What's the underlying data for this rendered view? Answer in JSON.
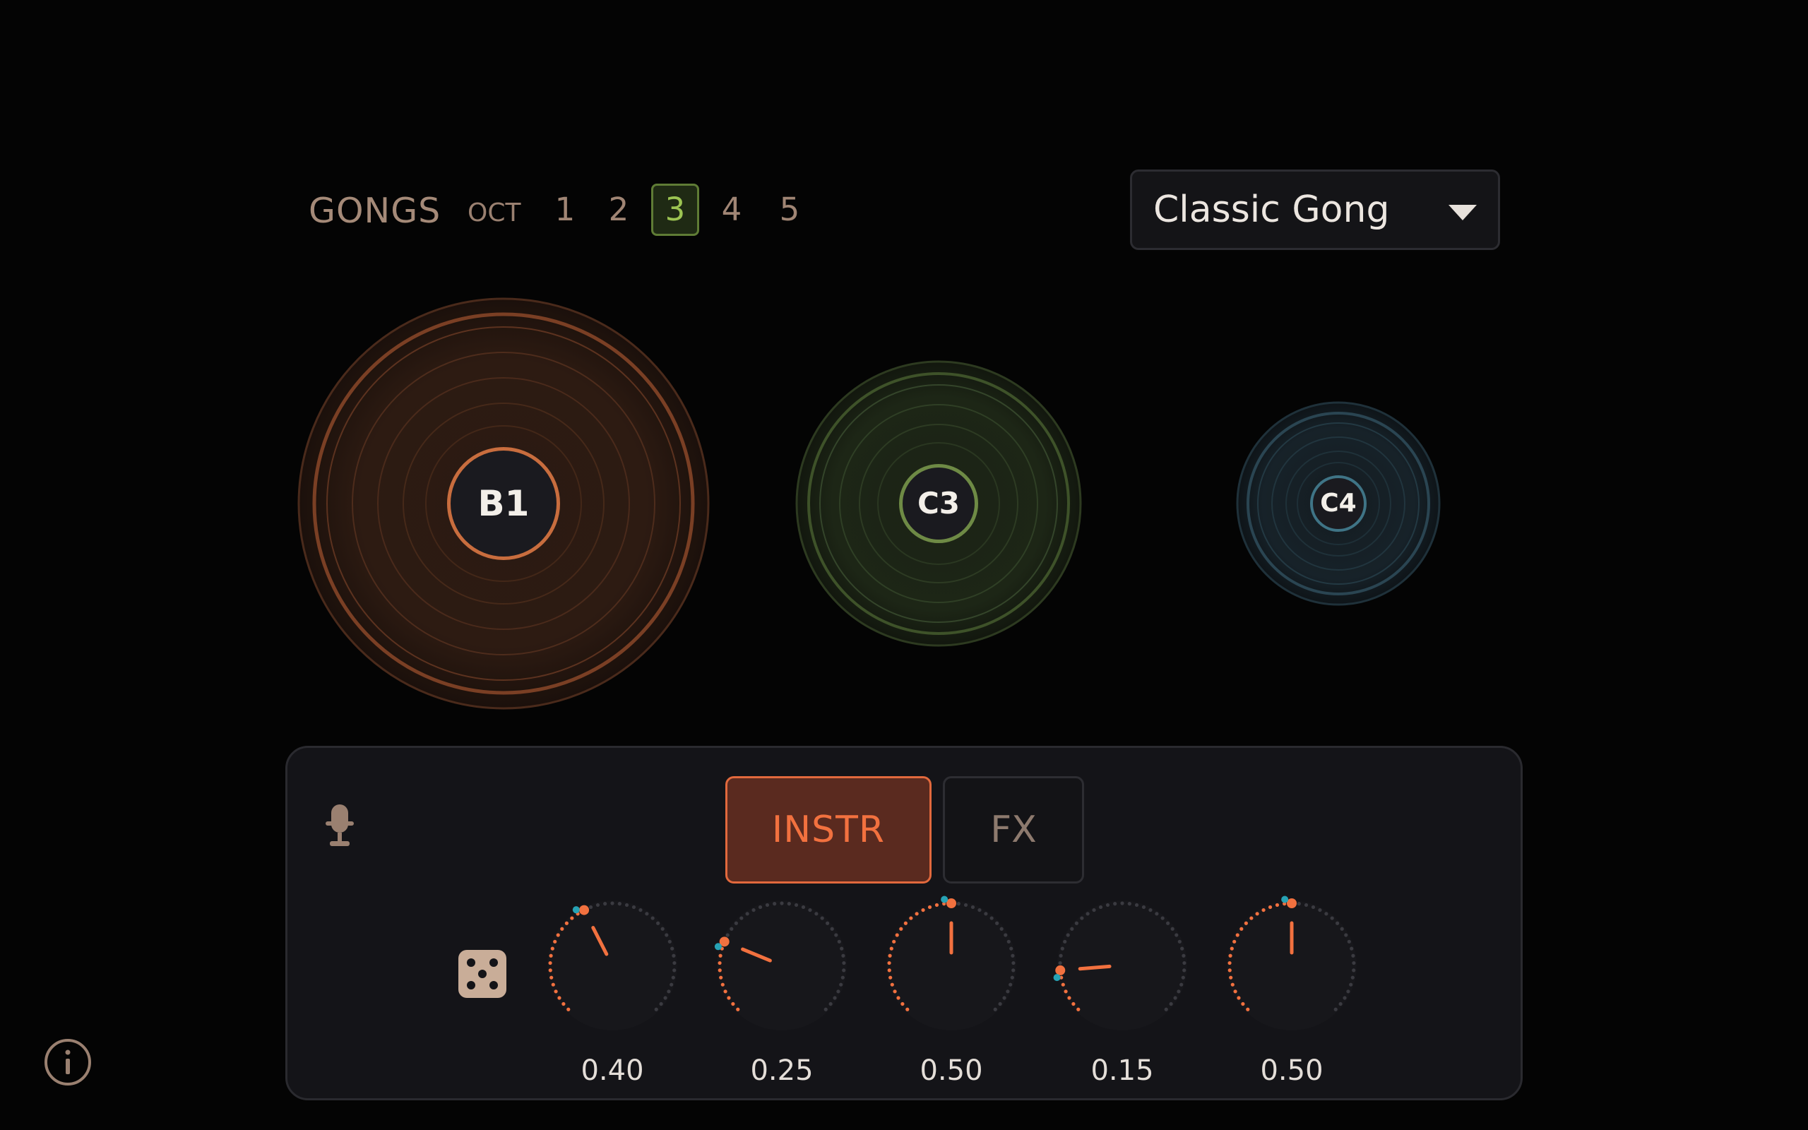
{
  "header": {
    "gongs_label": "GONGS",
    "oct_label": "OCT",
    "octaves": [
      "1",
      "2",
      "3",
      "4",
      "5"
    ],
    "active_octave": "3"
  },
  "preset": {
    "selected": "Classic Gong"
  },
  "gongs": [
    {
      "note": "B1",
      "color": "#c86d3e"
    },
    {
      "note": "C3",
      "color": "#6e8a45"
    },
    {
      "note": "C4",
      "color": "#3f7486"
    }
  ],
  "panel": {
    "tabs": {
      "instr": "INSTR",
      "fx": "FX"
    },
    "active_tab": "INSTR",
    "knobs": [
      {
        "value": 0.4,
        "label": "0.40"
      },
      {
        "value": 0.25,
        "label": "0.25"
      },
      {
        "value": 0.5,
        "label": "0.50"
      },
      {
        "value": 0.15,
        "label": "0.15"
      },
      {
        "value": 0.5,
        "label": "0.50"
      }
    ]
  },
  "colors": {
    "accent": "#f2713f",
    "octave_active": "#9cc452",
    "background": "#040404",
    "modulation": "#27a2b4"
  },
  "icons": {
    "mic": "microphone-icon",
    "dice": "dice-icon",
    "info": "info-icon",
    "dropdown": "chevron-down-icon"
  }
}
